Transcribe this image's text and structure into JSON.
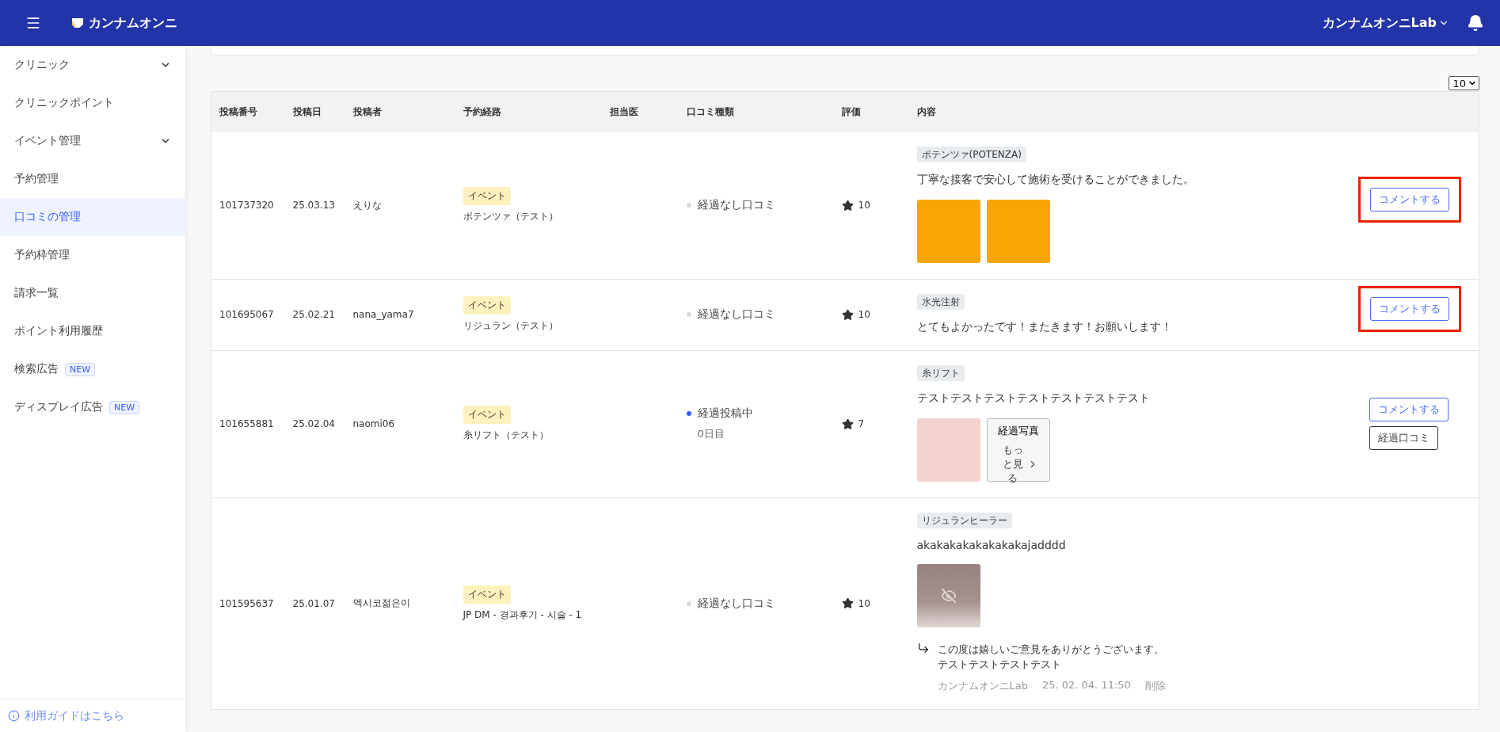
{
  "header": {
    "brand": "カンナムオンニ",
    "account": "カンナムオンニLab"
  },
  "sidebar": {
    "items": [
      {
        "label": "クリニック",
        "selected": false,
        "has_submenu": true
      },
      {
        "label": "クリニックポイント",
        "selected": false,
        "has_submenu": false
      },
      {
        "label": "イベント管理",
        "selected": false,
        "has_submenu": true
      },
      {
        "label": "予約管理",
        "selected": false,
        "has_submenu": false
      },
      {
        "label": "口コミの管理",
        "selected": true,
        "has_submenu": false
      },
      {
        "label": "予約枠管理",
        "selected": false,
        "has_submenu": false
      },
      {
        "label": "請求一覧",
        "selected": false,
        "has_submenu": false
      },
      {
        "label": "ポイント利用履歴",
        "selected": false,
        "has_submenu": false
      },
      {
        "label": "検索広告",
        "selected": false,
        "has_submenu": false,
        "badge": "NEW"
      },
      {
        "label": "ディスプレイ広告",
        "selected": false,
        "has_submenu": false,
        "badge": "NEW"
      }
    ],
    "guide_link": "利用ガイドはこちら"
  },
  "page_size": "10",
  "table": {
    "columns": [
      "投稿番号",
      "投稿日",
      "投稿者",
      "予約経路",
      "担当医",
      "口コミ種類",
      "評価",
      "内容"
    ],
    "rows": [
      {
        "id": "101737320",
        "date": "25.03.13",
        "author": "えりな",
        "route": {
          "tag": "イベント",
          "name": "ポテンツァ（テスト）"
        },
        "review_type": {
          "label": "経過なし口コミ",
          "color": "#d9d9d9"
        },
        "rating": "10",
        "content": {
          "category": "ポテンツァ(POTENZA)",
          "text": "丁寧な接客で安心して施術を受けることができました。",
          "photos": [
            {
              "kind": "photo",
              "color": "#f8a505"
            },
            {
              "kind": "photo",
              "color": "#f8a505"
            }
          ]
        },
        "actions": [
          {
            "kind": "comment",
            "label": "コメントする"
          }
        ],
        "highlighted": true
      },
      {
        "id": "101695067",
        "date": "25.02.21",
        "author": "nana_yama7",
        "route": {
          "tag": "イベント",
          "name": "リジュラン（テスト）"
        },
        "review_type": {
          "label": "経過なし口コミ",
          "color": "#d9d9d9"
        },
        "rating": "10",
        "content": {
          "category": "水光注射",
          "text": "とてもよかったです！またきます！お願いします！"
        },
        "actions": [
          {
            "kind": "comment",
            "label": "コメントする"
          }
        ],
        "highlighted": true
      },
      {
        "id": "101655881",
        "date": "25.02.04",
        "author": "naomi06",
        "route": {
          "tag": "イベント",
          "name": "糸リフト（テスト）"
        },
        "review_type": {
          "label": "経過投稿中",
          "sub": "0日目",
          "color": "#3b5bfd"
        },
        "rating": "7",
        "content": {
          "category": "糸リフト",
          "text": "テストテストテストテストテストテストテスト",
          "photos": [
            {
              "kind": "photo",
              "color": "#f3d2cf"
            },
            {
              "kind": "more",
              "title": "経過写真",
              "label": "もっと見る"
            }
          ]
        },
        "actions": [
          {
            "kind": "comment",
            "label": "コメントする"
          },
          {
            "kind": "progress",
            "label": "経過口コミ"
          }
        ],
        "highlighted": false
      },
      {
        "id": "101595637",
        "date": "25.01.07",
        "author": "멕시코젊은이",
        "route": {
          "tag": "イベント",
          "name": "JP DM - 경과후기 - 시술 - 1"
        },
        "review_type": {
          "label": "経過なし口コミ",
          "color": "#d9d9d9"
        },
        "rating": "10",
        "content": {
          "category": "リジュランヒーラー",
          "text": "akakakakakakakakajadddd",
          "photos": [
            {
              "kind": "hidden",
              "color": "#9e8a86"
            }
          ],
          "reply": {
            "lines": [
              "この度は嬉しいご意見をありがとうございます。",
              "テストテストテストテスト"
            ],
            "author": "カンナムオンニLab",
            "time": "25. 02. 04. 11:50",
            "delete": "削除"
          }
        },
        "highlighted": false
      }
    ]
  }
}
